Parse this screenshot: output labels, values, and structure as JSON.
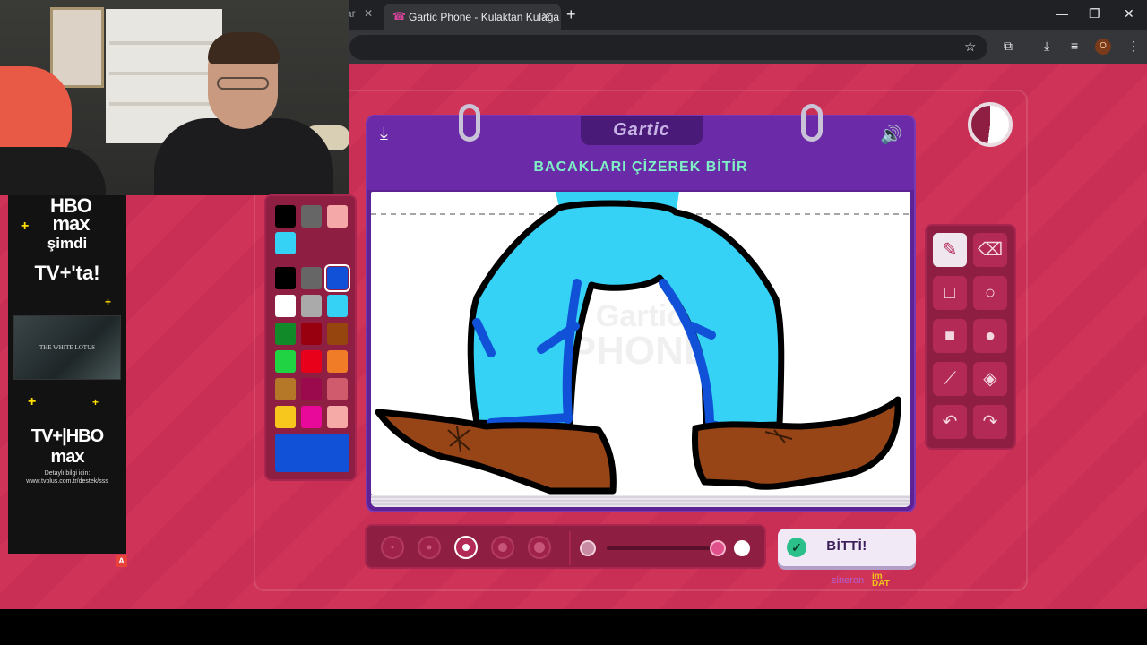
{
  "browser": {
    "prev_tab_suffix": "ar",
    "active_tab_title": "Gartic Phone - Kulaktan Kulağa",
    "close_glyph": "✕",
    "new_tab_glyph": "+",
    "window_controls": [
      "—",
      "❐",
      "✕"
    ],
    "profile_initial": "O"
  },
  "ad": {
    "hbo_line1": "HBO",
    "hbo_line2": "max",
    "simdi": "şimdi",
    "tv_ta": "TV+'ta!",
    "poster_caption": "THE WHITE LOTUS",
    "bundle_logo": "TV+|HBO max",
    "info_line1": "Detaylı bilgi için:",
    "info_line2": "www.tvplus.com.tr/destek/sss",
    "adchoice": "A"
  },
  "game": {
    "logo": "Gartic",
    "task": "BACAKLARI ÇİZEREK BİTİR",
    "watermark_line1": "Gartic",
    "watermark_line2": "PHONE",
    "done_label": "BİTTİ!",
    "credit_name": "sineron",
    "credit_logo_top": "im",
    "credit_logo_bottom": "DAT",
    "timer_remaining_fraction": 0.52,
    "selected_color": "#1051d8",
    "selected_size_index": 2,
    "opacity_fraction": 1.0
  },
  "palette": {
    "top": [
      "#000000",
      "#666666",
      "#f4a9a8",
      "#36d2f6"
    ],
    "grid": [
      "#000000",
      "#666666",
      "#1051d8",
      "#ffffff",
      "#aaaaaa",
      "#36d2f6",
      "#118a2a",
      "#99000f",
      "#97450f",
      "#1fd342",
      "#e8001a",
      "#f07c28",
      "#b47828",
      "#9a0a4d",
      "#cf5b6c",
      "#f8c71e",
      "#e8089a",
      "#f6aaa8"
    ],
    "current": "#1051d8"
  },
  "tools": [
    "pen-icon",
    "eraser-icon",
    "rect-outline-icon",
    "circle-outline-icon",
    "rect-fill-icon",
    "circle-fill-icon",
    "line-icon",
    "fill-bucket-icon",
    "undo-icon",
    "redo-icon"
  ],
  "colors": {
    "accent": "#6b2aa8",
    "page_bg": "#cf3458",
    "panel": "#8e1e42",
    "task_text": "#7ff0c6"
  }
}
